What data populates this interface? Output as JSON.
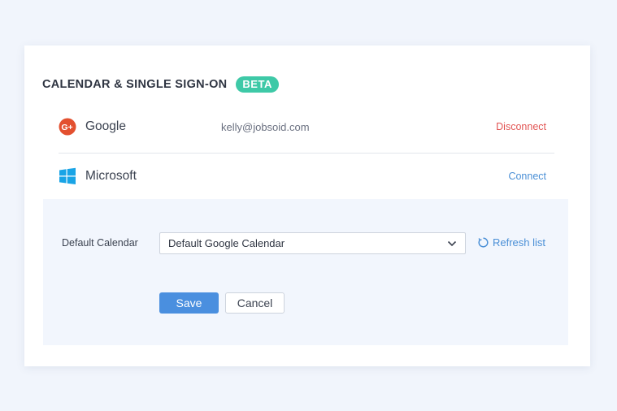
{
  "section": {
    "title": "CALENDAR & SINGLE SIGN-ON",
    "badge": "BETA"
  },
  "providers": [
    {
      "name": "Google",
      "icon": "google-plus-icon",
      "email": "kelly@jobsoid.com",
      "action": "Disconnect",
      "action_color": "#e25554"
    },
    {
      "name": "Microsoft",
      "icon": "windows-icon",
      "email": "",
      "action": "Connect",
      "action_color": "#4a8fd6"
    }
  ],
  "calendar": {
    "label": "Default Calendar",
    "selected": "Default Google Calendar",
    "refresh_label": "Refresh list"
  },
  "buttons": {
    "save": "Save",
    "cancel": "Cancel"
  },
  "colors": {
    "accent": "#4a8fdf",
    "badge": "#3ec9a7",
    "danger": "#e25554",
    "google": "#e3502f",
    "microsoft": "#19a4e6"
  }
}
